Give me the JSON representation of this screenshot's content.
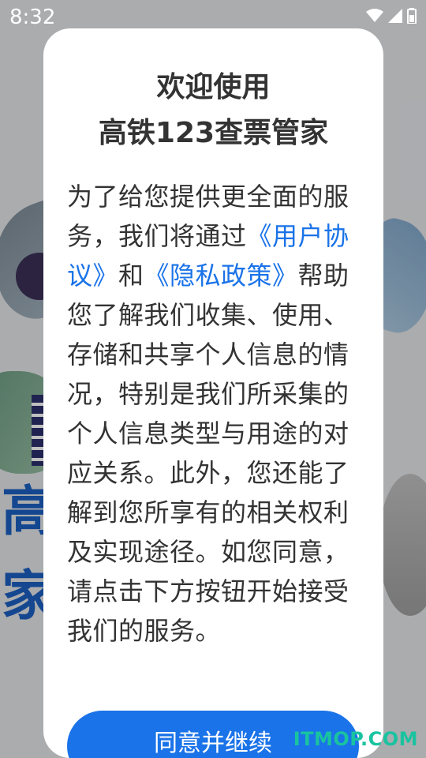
{
  "status_bar": {
    "time": "8:32",
    "icons": [
      "wifi-icon",
      "signal-icon",
      "battery-icon"
    ]
  },
  "background": {
    "title_line1": "高",
    "title_line2": "家"
  },
  "dialog": {
    "title_line1": "欢迎使用",
    "title_line2": "高铁123查票管家",
    "body_part1": "为了给您提供更全面的服务，我们将通过",
    "user_agreement_link": "《用户协议》",
    "body_part2": "和",
    "privacy_policy_link": "《隐私政策》",
    "body_part3": "帮助您了解我们收集、使用、存储和共享个人信息的情况，特别是我们所采集的个人信息类型与用途的对应关系。此外，您还能了解到您所享有的相关权利及实现途径。如您同意，请点击下方按钮开始接受我们的服务。",
    "agree_button_label": "同意并继续"
  },
  "watermark": "ITMOP.COM",
  "colors": {
    "accent": "#1a73e8",
    "brand_title": "#1b5fc0",
    "watermark": "#19c3a0"
  }
}
